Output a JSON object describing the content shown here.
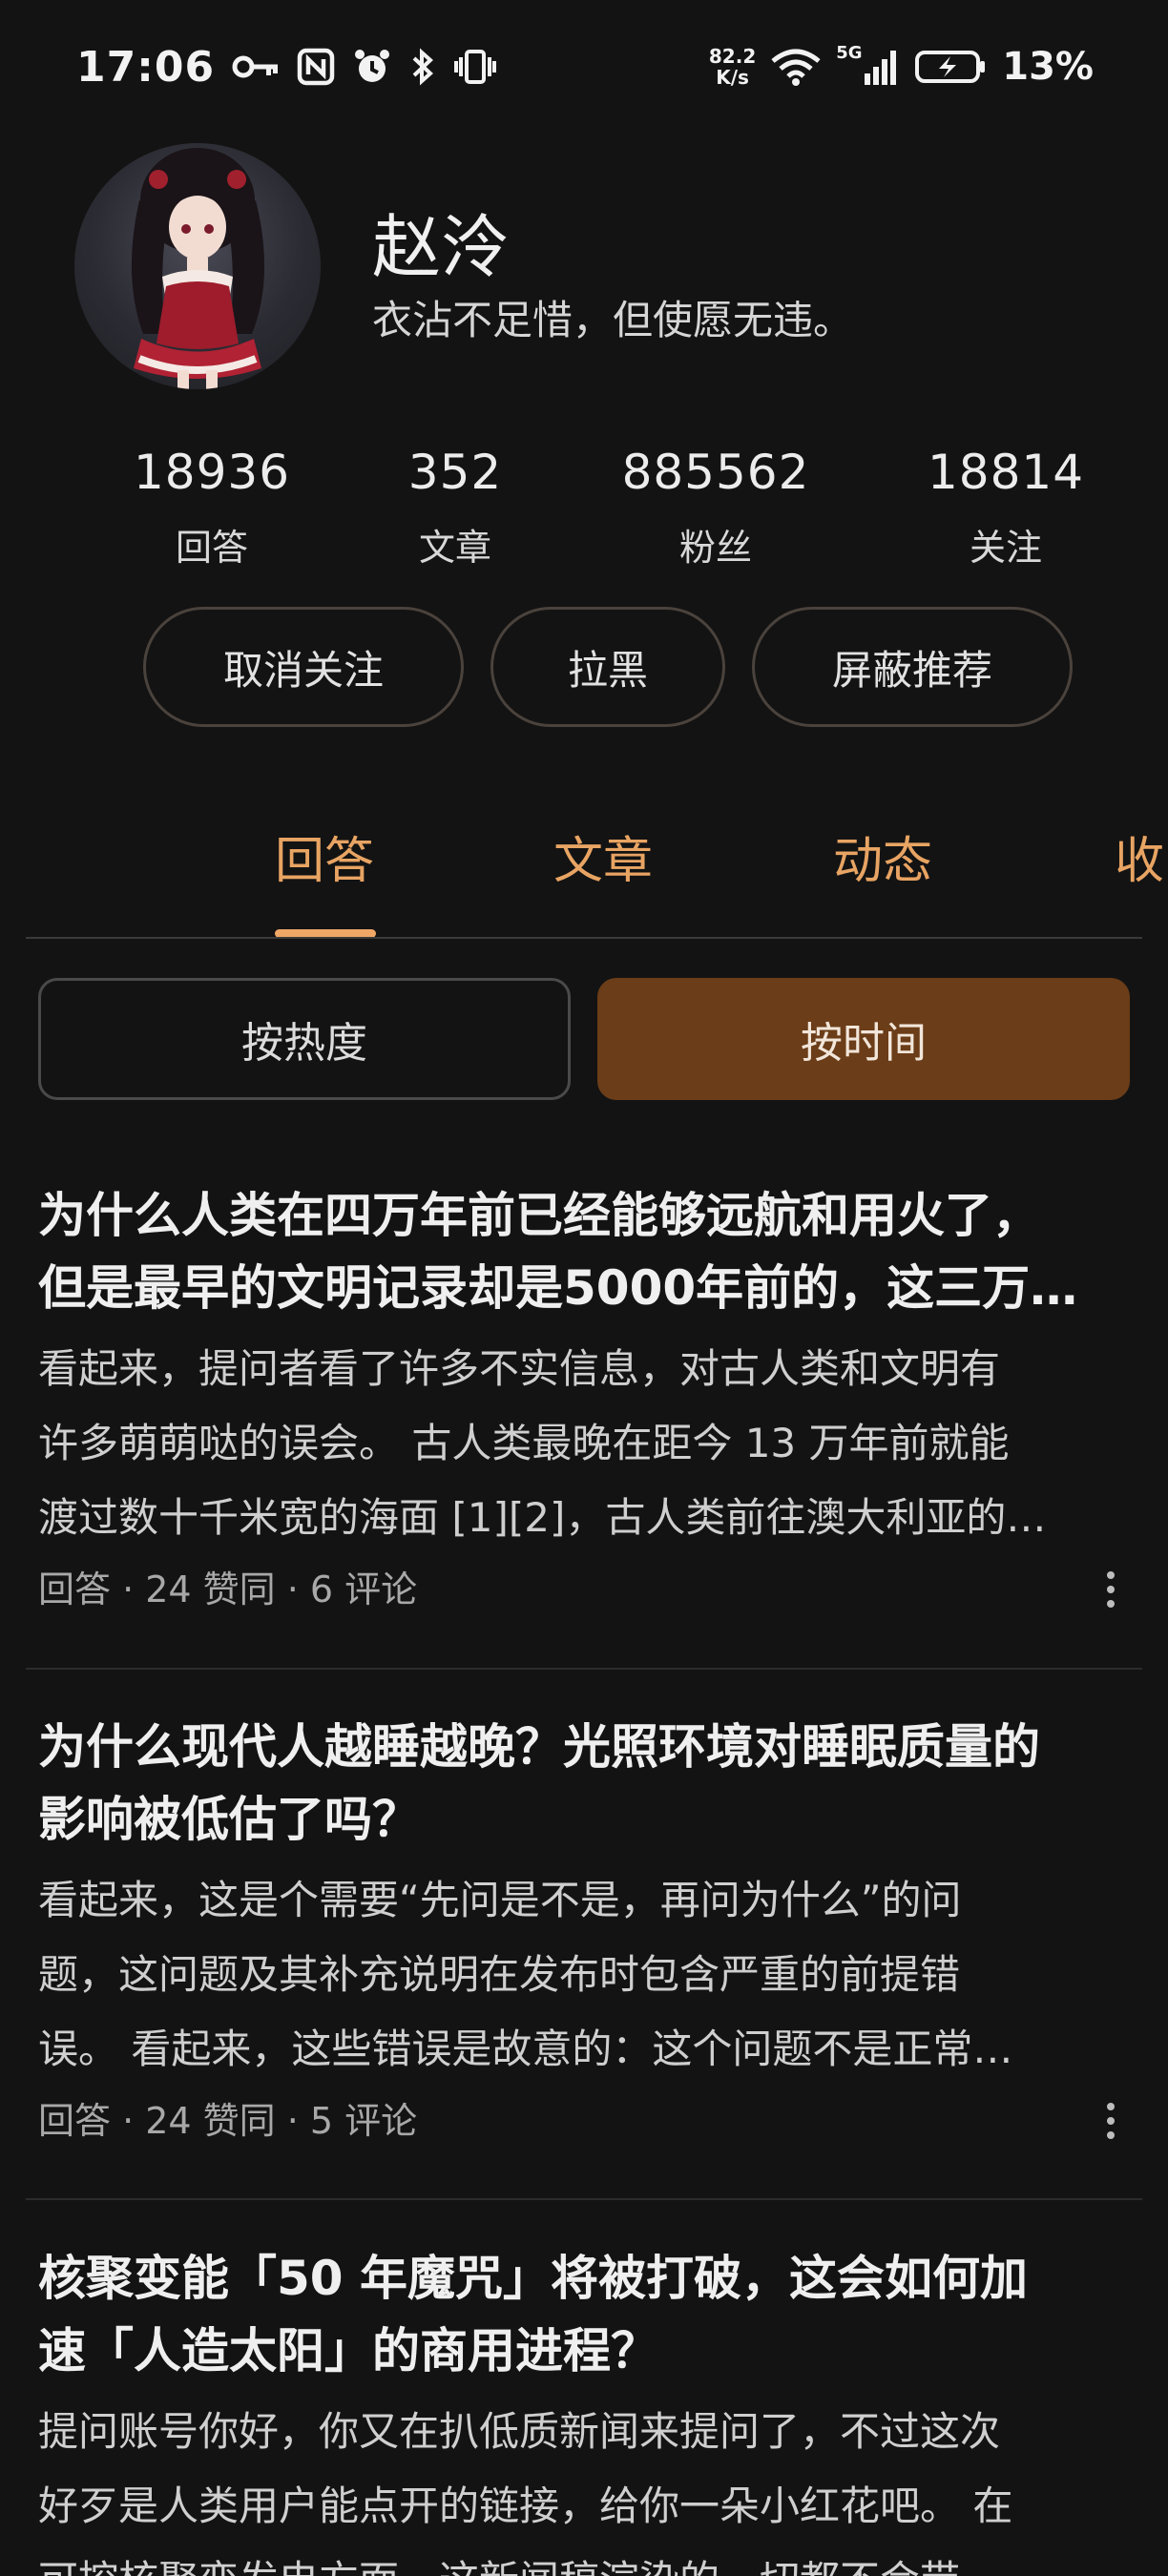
{
  "status_bar": {
    "time": "17:06",
    "net_speed_value": "82.2",
    "net_speed_unit": "K/s",
    "network": "5G",
    "battery": "13%"
  },
  "profile": {
    "name": "赵泠",
    "bio": "衣沾不足惜，但使愿无违。"
  },
  "stats": [
    {
      "value": "18936",
      "label": "回答"
    },
    {
      "value": "352",
      "label": "文章"
    },
    {
      "value": "885562",
      "label": "粉丝"
    },
    {
      "value": "18814",
      "label": "关注"
    }
  ],
  "actions": {
    "unfollow": "取消关注",
    "block": "拉黑",
    "mute_recommend": "屏蔽推荐"
  },
  "tabs": [
    {
      "label": "回答",
      "active": true
    },
    {
      "label": "文章",
      "active": false
    },
    {
      "label": "动态",
      "active": false
    },
    {
      "label": "收",
      "active": false
    }
  ],
  "sort": {
    "by_hot": "按热度",
    "by_time": "按时间",
    "selected": "按时间"
  },
  "feed": [
    {
      "title_line1": "为什么人类在四万年前已经能够远航和用火了，",
      "title_line2": "但是最早的文明记录却是5000年前的，这三万…",
      "excerpt_line1": "看起来，提问者看了许多不实信息，对古人类和文明有",
      "excerpt_line2": "许多萌萌哒的误会。 古人类最晚在距今 13 万年前就能",
      "excerpt_line3": "渡过数十千米宽的海面 [1][2]，古人类前往澳大利亚的…",
      "meta": "回答 · 24 赞同 · 6 评论"
    },
    {
      "title_line1": "为什么现代人越睡越晚？光照环境对睡眠质量的",
      "title_line2": "影响被低估了吗？",
      "excerpt_line1": "看起来，这是个需要“先问是不是，再问为什么”的问",
      "excerpt_line2": "题，这问题及其补充说明在发布时包含严重的前提错",
      "excerpt_line3": "误。 看起来，这些错误是故意的：这个问题不是正常…",
      "meta": "回答 · 24 赞同 · 5 评论"
    },
    {
      "title_line1": "核聚变能「50 年魔咒」将被打破，这会如何加",
      "title_line2": "速「人造太阳」的商用进程？",
      "excerpt_line1": "提问账号你好，你又在扒低质新闻来提问了，不过这次",
      "excerpt_line2": "好歹是人类用户能点开的链接，给你一朵小红花吧。 在",
      "excerpt_line3": "可控核聚变发电方面，这新闻稿渲染的一切都不会带"
    }
  ],
  "colors": {
    "background": "#131313",
    "accent": "#f0a766",
    "selected_sort_bg": "#6b3d18"
  }
}
